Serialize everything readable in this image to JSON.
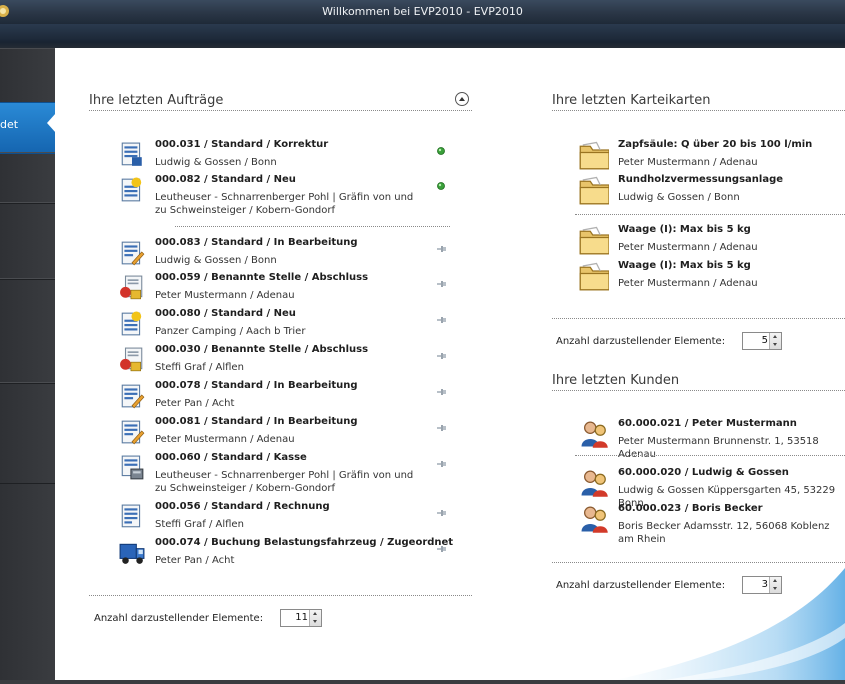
{
  "window": {
    "title": "Willkommen bei EVP2010 - EVP2010"
  },
  "sidebar": {
    "active_label": "det"
  },
  "orders": {
    "title": "Ihre letzten Aufträge",
    "items": [
      {
        "title": "000.031 / Standard / Korrektur",
        "subtitle": "Ludwig & Gossen / Bonn",
        "icon": "document-list-icon",
        "status": "green-dot-icon"
      },
      {
        "title": "000.082 / Standard / Neu",
        "subtitle": "Leutheuser - Schnarrenberger Pohl | Gräfin von und zu Schweinsteiger / Kobern-Gondorf",
        "icon": "document-new-icon",
        "status": "green-dot-icon"
      },
      {
        "title": "000.083 / Standard / In Bearbeitung",
        "subtitle": "Ludwig & Gossen / Bonn",
        "icon": "document-edit-icon",
        "status": "pin-icon"
      },
      {
        "title": "000.059 / Benannte Stelle / Abschluss",
        "subtitle": "Peter Mustermann / Adenau",
        "icon": "document-lock-icon",
        "status": "pin-icon"
      },
      {
        "title": "000.080 / Standard / Neu",
        "subtitle": "Panzer Camping / Aach b Trier",
        "icon": "document-new-icon",
        "status": "pin-icon"
      },
      {
        "title": "000.030 / Benannte Stelle / Abschluss",
        "subtitle": "Steffi Graf / Alflen",
        "icon": "document-lock-icon",
        "status": "pin-icon"
      },
      {
        "title": "000.078 / Standard / In Bearbeitung",
        "subtitle": "Peter Pan / Acht",
        "icon": "document-edit-icon",
        "status": "pin-icon"
      },
      {
        "title": "000.081 / Standard / In Bearbeitung",
        "subtitle": "Peter Mustermann / Adenau",
        "icon": "document-edit-icon",
        "status": "pin-icon"
      },
      {
        "title": "000.060 / Standard / Kasse",
        "subtitle": "Leutheuser - Schnarrenberger Pohl | Gräfin von und zu Schweinsteiger / Kobern-Gondorf",
        "icon": "document-register-icon",
        "status": "pin-icon"
      },
      {
        "title": "000.056 / Standard / Rechnung",
        "subtitle": "Steffi Graf / Alflen",
        "icon": "document-invoice-icon",
        "status": "pin-icon"
      },
      {
        "title": "000.074 / Buchung Belastungsfahrzeug / Zugeordnet",
        "subtitle": "Peter Pan / Acht",
        "icon": "truck-icon",
        "status": "pin-icon"
      }
    ],
    "count_label": "Anzahl darzustellender Elemente:",
    "count_value": "11"
  },
  "cards": {
    "title": "Ihre letzten Karteikarten",
    "items": [
      {
        "title": "Zapfsäule: Q über 20 bis 100 l/min",
        "subtitle": "Peter Mustermann / Adenau",
        "icon": "folder-icon"
      },
      {
        "title": "Rundholzvermessungsanlage",
        "subtitle": "Ludwig & Gossen / Bonn",
        "icon": "folder-icon"
      },
      {
        "title": "Waage (I): Max bis 5 kg",
        "subtitle": "Peter Mustermann / Adenau",
        "icon": "folder-icon"
      },
      {
        "title": "Waage (I): Max bis 5 kg",
        "subtitle": "Peter Mustermann / Adenau",
        "icon": "folder-icon"
      }
    ],
    "count_label": "Anzahl darzustellender Elemente:",
    "count_value": "5"
  },
  "customers": {
    "title": "Ihre letzten Kunden",
    "items": [
      {
        "title": "60.000.021 / Peter Mustermann",
        "subtitle": "Peter Mustermann Brunnenstr. 1, 53518 Adenau",
        "icon": "users-icon"
      },
      {
        "title": "60.000.020 / Ludwig & Gossen",
        "subtitle": "Ludwig & Gossen Küppersgarten 45, 53229 Bonn",
        "icon": "users-icon"
      },
      {
        "title": "60.000.023 / Boris Becker",
        "subtitle": "Boris Becker Adamsstr. 12, 56068 Koblenz am Rhein",
        "icon": "users-icon"
      }
    ],
    "count_label": "Anzahl darzustellender Elemente:",
    "count_value": "3"
  }
}
